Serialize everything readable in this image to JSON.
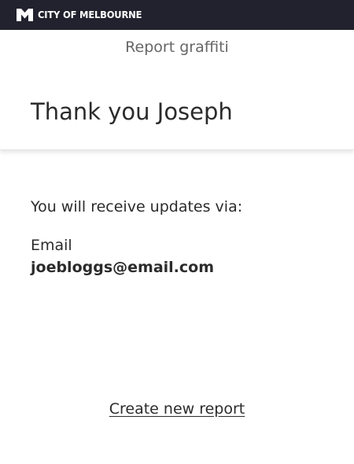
{
  "brand": {
    "logo_icon": "city-of-melbourne-m-logo",
    "name": "CITY OF MELBOURNE",
    "bar_color": "#22222e"
  },
  "header": {
    "subtitle": "Report graffiti",
    "title": "Thank you Joseph"
  },
  "main": {
    "updates_label": "You will receive updates via:",
    "channel_label": "Email",
    "channel_value": "joebloggs@email.com",
    "new_report_link": "Create new report"
  }
}
